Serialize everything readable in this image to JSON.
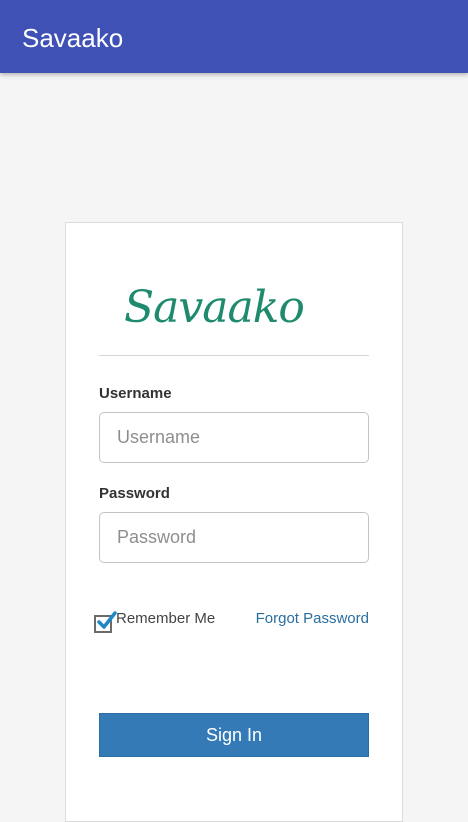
{
  "appbar": {
    "title": "Savaako",
    "color": "#3f51b5"
  },
  "login": {
    "logo_text": "Savaako",
    "logo_color": "#1e8a6e",
    "username_label": "Username",
    "username_placeholder": "Username",
    "username_value": "",
    "password_label": "Password",
    "password_placeholder": "Password",
    "password_value": "",
    "remember_label": "Remember Me",
    "remember_checked": true,
    "checkmark_color": "#1e88c7",
    "forgot_label": "Forgot Password",
    "signin_label": "Sign In",
    "button_color": "#337ab7"
  }
}
